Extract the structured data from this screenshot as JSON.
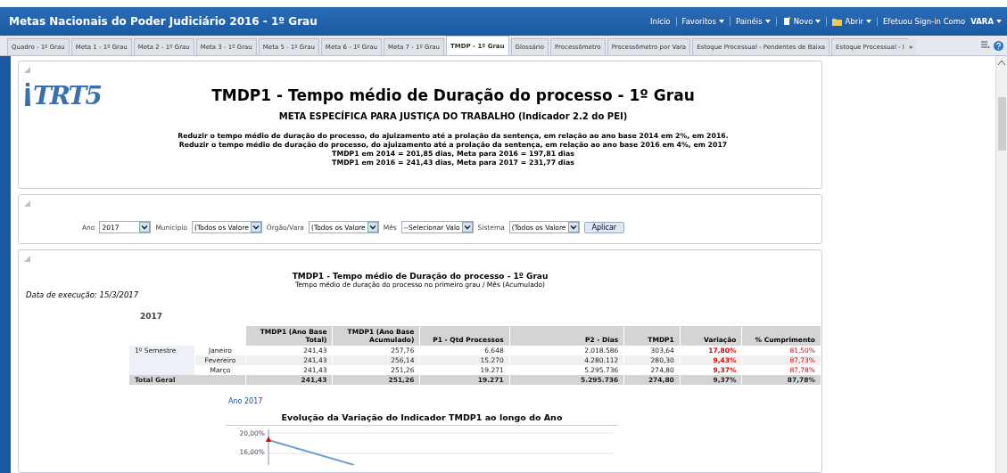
{
  "header": {
    "title": "Metas Nacionais do Poder Judiciário 2016 - 1º Grau",
    "nav": [
      {
        "label": "Início",
        "kind": "link"
      },
      {
        "label": "Favoritos",
        "kind": "menu"
      },
      {
        "label": "Painéis",
        "kind": "menu"
      },
      {
        "label": "Novo",
        "kind": "new"
      },
      {
        "label": "Abrir",
        "kind": "open"
      },
      {
        "label": "Efetuou Sign-in Como",
        "kind": "text"
      }
    ],
    "user": "VARA"
  },
  "tabs": [
    {
      "label": "Quadro - 1º Grau",
      "selected": false
    },
    {
      "label": "Meta 1 - 1º Grau",
      "selected": false
    },
    {
      "label": "Meta 2 - 1º Grau",
      "selected": false
    },
    {
      "label": "Meta 3 - 1º Grau",
      "selected": false
    },
    {
      "label": "Meta 5 - 1º Grau",
      "selected": false
    },
    {
      "label": "Meta 6 - 1º Grau",
      "selected": false
    },
    {
      "label": "Meta 7 - 1º Grau",
      "selected": false
    },
    {
      "label": "TMDP - 1º Grau",
      "selected": true
    },
    {
      "label": "Glossário",
      "selected": false
    },
    {
      "label": "Processômetro",
      "selected": false
    },
    {
      "label": "Processômetro por Vara",
      "selected": false
    },
    {
      "label": "Estoque Processual - Pendentes de Baixa",
      "selected": false
    },
    {
      "label": "Estoque Processual - I",
      "selected": false
    }
  ],
  "tabs_more": "»",
  "intro": {
    "logo_text": "TRT5",
    "title": "TMDP1 - Tempo médio de Duração do processo - 1º Grau",
    "subtitle": "META ESPECÍFICA PARA JUSTIÇA DO TRABALHO (Indicador 2.2 do PEI)",
    "lines": [
      "Reduzir o tempo médio de duração do processo, do ajuizamento até a prolação da sentença, em relação ao ano base 2014 em 2%, em 2016.",
      "Reduzir o tempo médio de duração do processo, do ajuizamento até a prolação da sentença, em relação ao ano base 2016 em 4%, em 2017",
      "TMDP1 em 2014 = 201,85 dias, Meta para 2016 = 197,81 dias",
      "TMDP1 em 2016 = 241,43 dias, Meta para 2017 = 231,77 dias"
    ]
  },
  "filters": [
    {
      "label": "Ano",
      "value": "2017"
    },
    {
      "label": "Municipio",
      "value": "(Todos os Valore"
    },
    {
      "label": "Órgão/Vara",
      "value": "(Todos os Valore"
    },
    {
      "label": "Mês",
      "value": "--Selecionar Valo"
    },
    {
      "label": "Sistema",
      "value": "(Todos os Valore"
    }
  ],
  "apply_button": "Aplicar",
  "report": {
    "title": "TMDP1 - Tempo médio de Duração do processo - 1º Grau",
    "subtitle": "Tempo médio de duração do processo no primeiro grau / Mês (Acumulado)",
    "run_date": "Data de execução: 15/3/2017",
    "year": "2017",
    "columns": [
      "TMDP1 (Ano Base Total)",
      "TMDP1 (Ano Base Acumulado)",
      "P1 - Qtd Processos",
      "P2 - Dias",
      "TMDP1",
      "Variação",
      "% Cumprimento"
    ],
    "group": "1º Semestre",
    "rows": [
      {
        "month": "Janeiro",
        "cells": [
          "241,43",
          "257,76",
          "6.648",
          "2.018.586",
          "303,64",
          "17,80%",
          "81,50%"
        ],
        "alert": true
      },
      {
        "month": "Fevereiro",
        "cells": [
          "241,43",
          "256,14",
          "15.270",
          "4.280.112",
          "280,30",
          "9,43%",
          "87,73%"
        ],
        "alert": true
      },
      {
        "month": "Março",
        "cells": [
          "241,43",
          "251,26",
          "19.271",
          "5.295.736",
          "274,80",
          "9,37%",
          "87,78%"
        ],
        "alert": true
      }
    ],
    "total": {
      "label": "Total Geral",
      "cells": [
        "241,43",
        "251,26",
        "19.271",
        "5.295.736",
        "274,80",
        "9,37%",
        "87,78%"
      ]
    }
  },
  "chart": {
    "link": "Ano 2017",
    "title": "Evolução da Variação do Indicador TMDP1 ao longo do Ano",
    "tick_labels": [
      "20,00%",
      "16,00%"
    ]
  }
}
